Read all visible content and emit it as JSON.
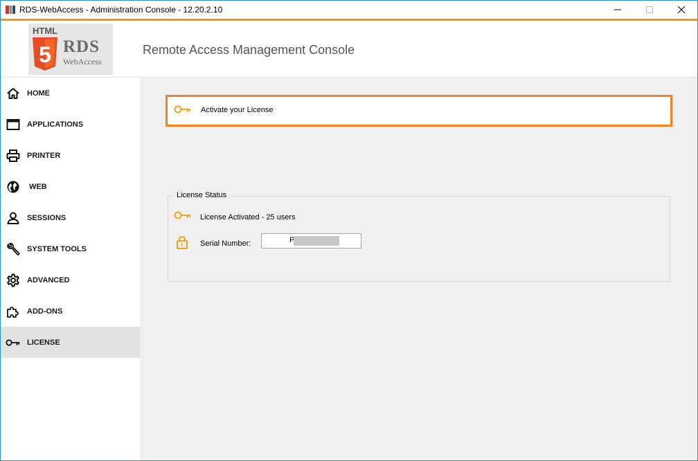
{
  "window": {
    "title": "RDS-WebAccess - Administration Console - 12.20.2.10"
  },
  "header": {
    "logo": {
      "html_label": "HTML",
      "shield_glyph": "5",
      "brand": "RDS",
      "product": "WebAccess"
    },
    "title": "Remote Access Management Console"
  },
  "sidebar": {
    "items": [
      {
        "label": "HOME",
        "icon": "home-icon"
      },
      {
        "label": "APPLICATIONS",
        "icon": "window-icon"
      },
      {
        "label": "PRINTER",
        "icon": "printer-icon"
      },
      {
        "label": "WEB",
        "icon": "globe-icon"
      },
      {
        "label": "SESSIONS",
        "icon": "user-icon"
      },
      {
        "label": "SYSTEM TOOLS",
        "icon": "wrench-icon"
      },
      {
        "label": "ADVANCED",
        "icon": "gear-icon"
      },
      {
        "label": "ADD-ONS",
        "icon": "puzzle-icon"
      },
      {
        "label": "LICENSE",
        "icon": "key-icon",
        "active": true
      }
    ]
  },
  "main": {
    "activate": {
      "label": "Activate your License",
      "icon": "key-icon"
    },
    "license_status": {
      "legend": "License Status",
      "activated_label": "License Activated - 25 users",
      "serial_label": "Serial Number:",
      "serial_value": "P",
      "serial_redacted": true
    }
  },
  "colors": {
    "accent_orange": "#f58220",
    "title_bar_accent": "#f7931e",
    "icon_orange": "#f7a21b",
    "sidebar_active_bg": "#e2e2e2",
    "content_bg": "#f0f0f0"
  }
}
